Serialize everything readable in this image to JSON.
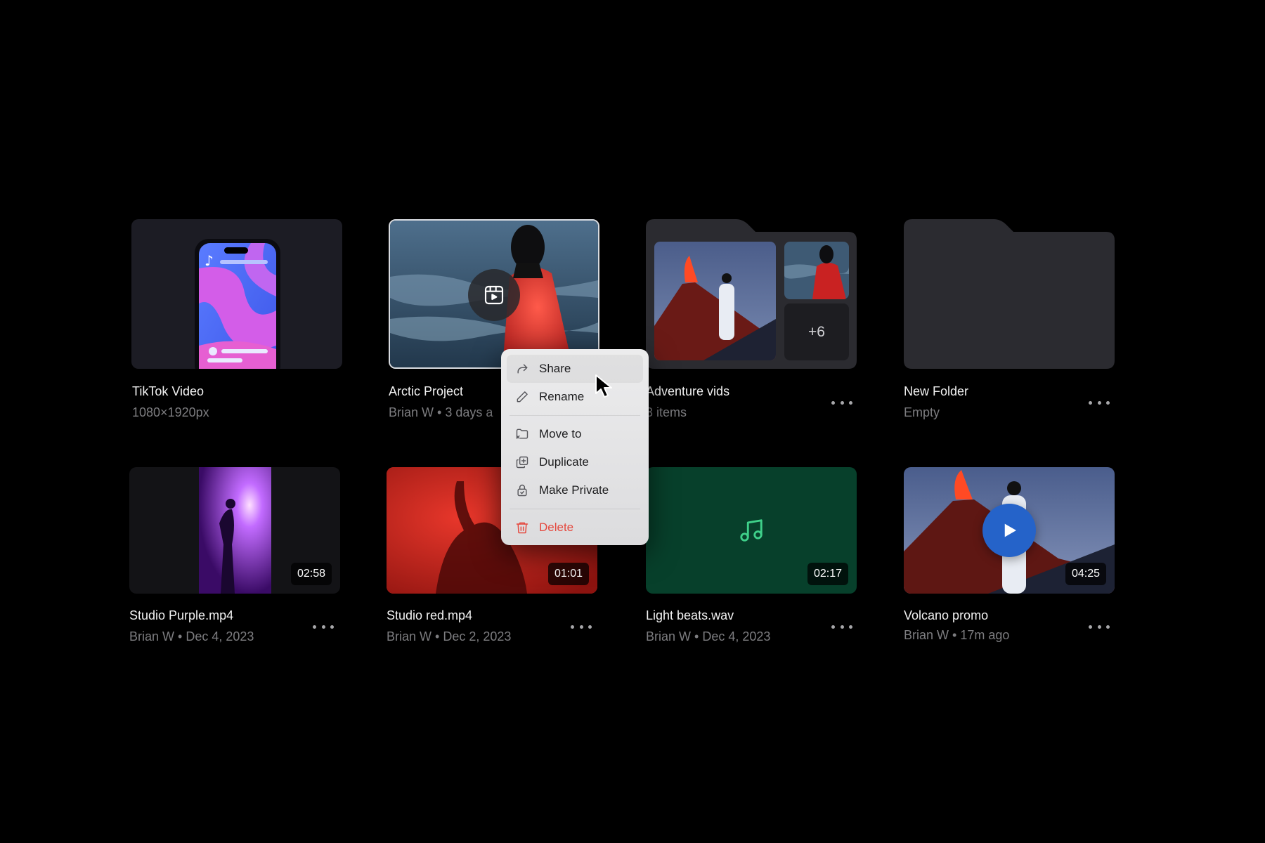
{
  "files": [
    {
      "title": "TikTok Video",
      "meta": "1080×1920px"
    },
    {
      "title": "Arctic Project",
      "meta": "Brian W • 3 days a"
    },
    {
      "title": "Adventure vids",
      "meta": "3 items",
      "extra": "+6"
    },
    {
      "title": "New Folder",
      "meta": "Empty"
    },
    {
      "title": "Studio Purple.mp4",
      "meta": "Brian W • Dec 4, 2023",
      "duration": "02:58"
    },
    {
      "title": "Studio red.mp4",
      "meta": "Brian W • Dec 2, 2023",
      "duration": "01:01"
    },
    {
      "title": "Light beats.wav",
      "meta": "Brian W • Dec 4, 2023",
      "duration": "02:17"
    },
    {
      "title": "Volcano promo",
      "meta": "Brian W • 17m ago",
      "duration": "04:25"
    }
  ],
  "context_menu": {
    "items": [
      {
        "label": "Share",
        "icon": "share-icon"
      },
      {
        "label": "Rename",
        "icon": "pencil-icon"
      },
      {
        "label": "Move to",
        "icon": "folder-move-icon"
      },
      {
        "label": "Duplicate",
        "icon": "duplicate-icon"
      },
      {
        "label": "Make Private",
        "icon": "lock-icon"
      },
      {
        "label": "Delete",
        "icon": "trash-icon"
      }
    ]
  },
  "colors": {
    "background": "#000000",
    "danger": "#e5483e",
    "audio_card": "#07402b",
    "play_button": "#2563c9"
  }
}
